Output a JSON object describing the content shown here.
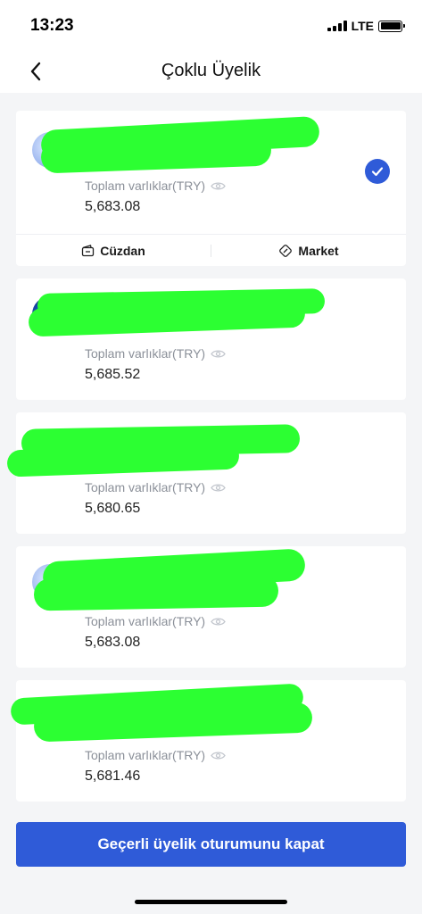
{
  "status_bar": {
    "time": "13:23",
    "network": "LTE"
  },
  "header": {
    "title": "Çoklu Üyelik"
  },
  "accounts": [
    {
      "label": "Toplam varlıklar(TRY)",
      "amount": "5,683.08",
      "selected": true
    },
    {
      "label": "Toplam varlıklar(TRY)",
      "amount": "5,685.52",
      "selected": false
    },
    {
      "label": "Toplam varlıklar(TRY)",
      "amount": "5,680.65",
      "selected": false
    },
    {
      "label": "Toplam varlıklar(TRY)",
      "amount": "5,683.08",
      "selected": false
    },
    {
      "label": "Toplam varlıklar(TRY)",
      "amount": "5,681.46",
      "selected": false
    }
  ],
  "card_actions": {
    "wallet": "Cüzdan",
    "market": "Market"
  },
  "footer": {
    "logout_label": "Geçerli üyelik oturumunu kapat"
  },
  "colors": {
    "accent": "#2f5bd8",
    "redaction": "#2cff32",
    "background": "#f4f5f7"
  }
}
